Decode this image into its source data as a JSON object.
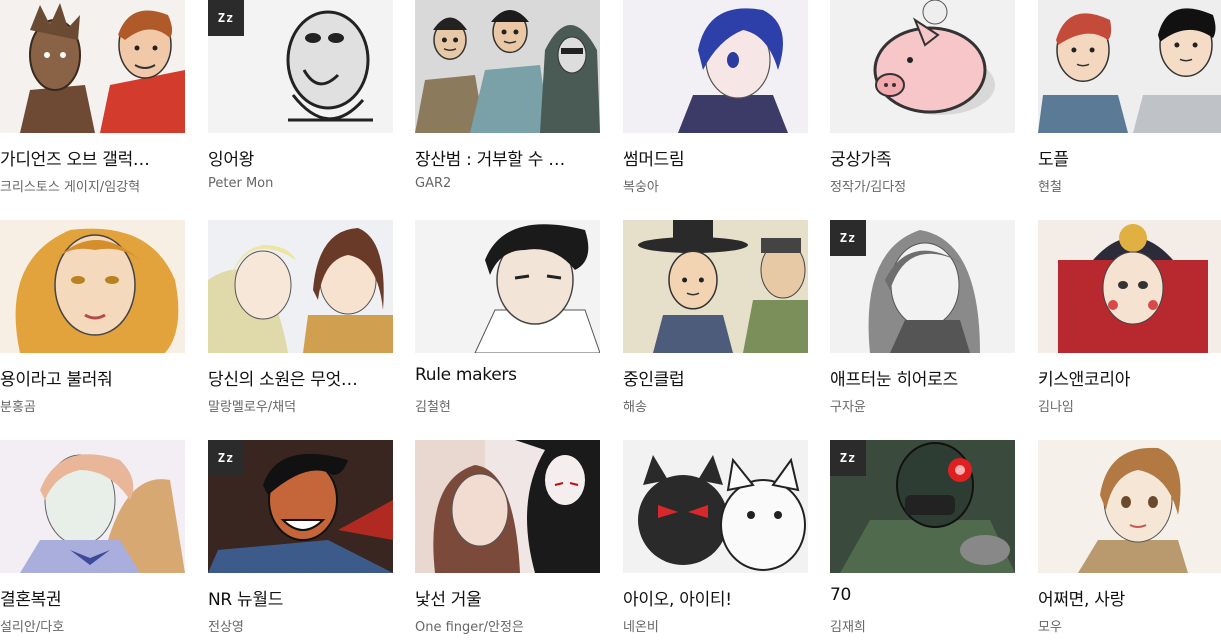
{
  "webtoons": [
    {
      "title": "가디언즈 오브 갤럭…",
      "author": "크리스토스 게이지/임강혁",
      "zz": false,
      "art": "guardians",
      "bg": "#f4f1ee"
    },
    {
      "title": "잉어왕",
      "author": "Peter Mon",
      "zz": true,
      "art": "blob",
      "bg": "#f3f3f3"
    },
    {
      "title": "장산범 : 거부할 수 …",
      "author": "GAR2",
      "zz": false,
      "art": "three-men",
      "bg": "#e9e9e9"
    },
    {
      "title": "썸머드림",
      "author": "복숭아",
      "zz": false,
      "art": "blue-boy",
      "bg": "#f2f0f5"
    },
    {
      "title": "궁상가족",
      "author": "정작가/김다정",
      "zz": false,
      "art": "piggy",
      "bg": "#f1f1f1"
    },
    {
      "title": "도플",
      "author": "현철",
      "zz": false,
      "art": "twins",
      "bg": "#eeeeee"
    },
    {
      "title": "용이라고 불러줘",
      "author": "분홍곰",
      "zz": false,
      "art": "blonde-woman",
      "bg": "#f7efe4"
    },
    {
      "title": "당신의 소원은 무엇…",
      "author": "말랑멜로우/채덕",
      "zz": false,
      "art": "two-girls",
      "bg": "#eef0f4"
    },
    {
      "title": "Rule makers",
      "author": "김철현",
      "zz": false,
      "art": "dark-hair-boy",
      "bg": "#f3f3f3"
    },
    {
      "title": "중인클럽",
      "author": "해송",
      "zz": false,
      "art": "joseon",
      "bg": "#efeadf"
    },
    {
      "title": "애프터눈 히어로즈",
      "author": "구자윤",
      "zz": true,
      "art": "gray-girl",
      "bg": "#f2f2f2"
    },
    {
      "title": "키스앤코리아",
      "author": "김나임",
      "zz": false,
      "art": "bride",
      "bg": "#f4ece6"
    },
    {
      "title": "결혼복권",
      "author": "설리안/다호",
      "zz": false,
      "art": "pale-woman",
      "bg": "#f2eef3"
    },
    {
      "title": "NR 뉴월드",
      "author": "전상영",
      "zz": true,
      "art": "nr-man",
      "bg": "#3b2a26"
    },
    {
      "title": "낯선 거울",
      "author": "One finger/안정은",
      "zz": false,
      "art": "mirror",
      "bg": "#f0e6e6"
    },
    {
      "title": "아이오, 아이티!",
      "author": "네온비",
      "zz": false,
      "art": "cats",
      "bg": "#f2f2f2"
    },
    {
      "title": "70",
      "author": "김재희",
      "zz": true,
      "art": "soldier",
      "bg": "#2d3a30"
    },
    {
      "title": "어쩌면, 사랑",
      "author": "모우",
      "zz": false,
      "art": "short-hair",
      "bg": "#f5f1ea"
    }
  ],
  "badge_text": "Zz"
}
